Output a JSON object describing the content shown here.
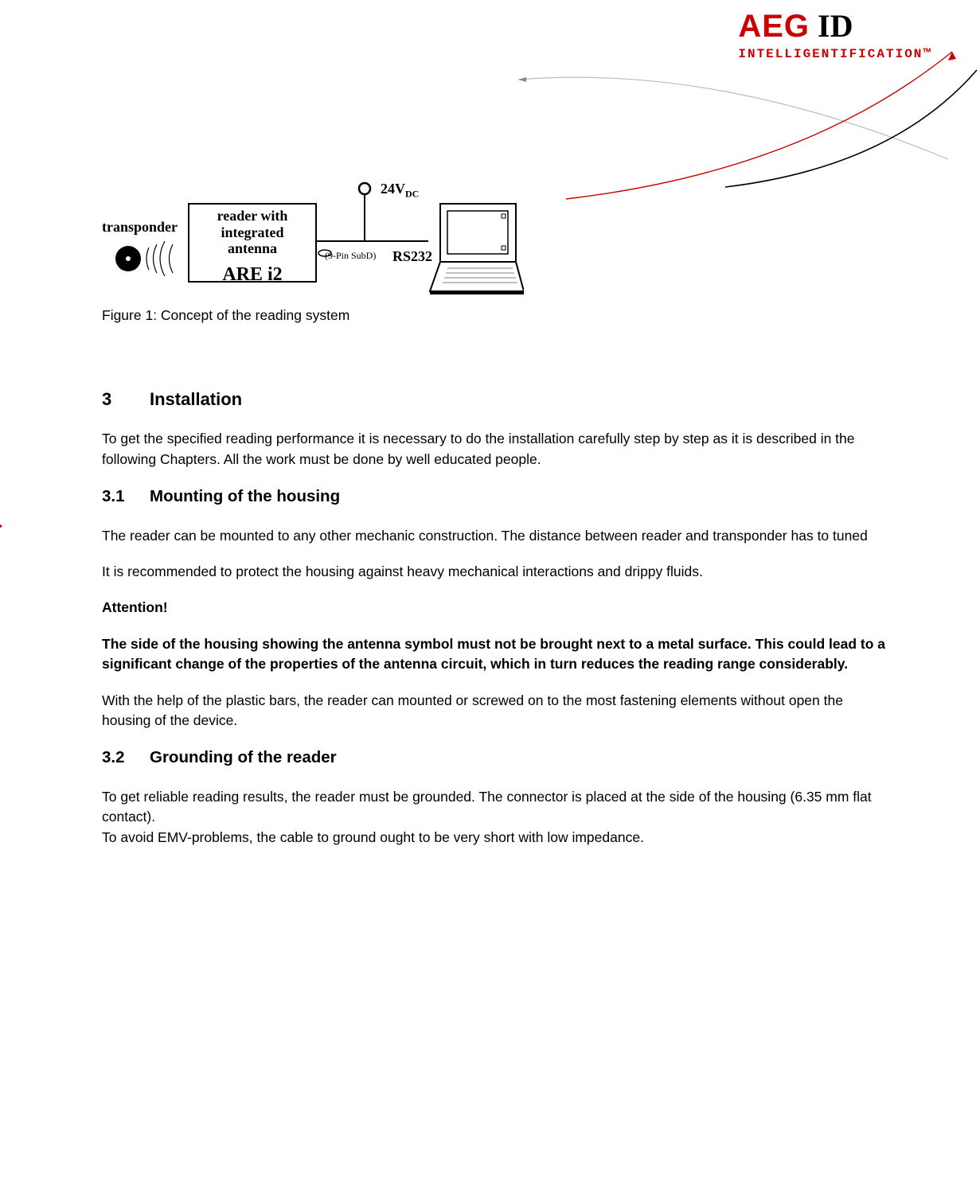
{
  "header": {
    "logo_main": "AEG",
    "logo_sub": "ID",
    "tagline": "INTELLIGENTIFICATION™"
  },
  "diagram": {
    "transponder_label": "transponder",
    "reader_line1": "reader with",
    "reader_line2": "integrated",
    "reader_line3": "antenna",
    "reader_model": "ARE i2",
    "pin_label": "(9-Pin  SubD)",
    "rs232_label": "RS232",
    "voltage_main": "24V",
    "voltage_sub": "DC",
    "caption": "Figure 1: Concept of the reading system"
  },
  "sections": {
    "s3": {
      "num": "3",
      "title": "Installation",
      "p1": "To get the specified reading performance it is necessary to do the installation carefully step by step as it is described in the following Chapters. All the work must be done by well educated people."
    },
    "s31": {
      "num": "3.1",
      "title": "Mounting of the housing",
      "p1": "The reader can be mounted to any other mechanic construction. The distance between reader and transponder has to tuned",
      "p2": "It is recommended to protect the housing against heavy mechanical interactions and drippy fluids.",
      "attn": "Attention!",
      "p3": "The side of the housing showing the antenna symbol must not be brought next to a metal surface. This could lead to a significant change of the properties of the antenna circuit, which in turn reduces the reading range considerably.",
      "p4": "With the help of the plastic bars, the reader can mounted or screwed on to the most fastening elements without open the housing of the device."
    },
    "s32": {
      "num": "3.2",
      "title": "Grounding of the reader",
      "p1": "To get reliable reading results, the reader must be grounded. The connector is placed at the side of the housing (6.35 mm flat contact).",
      "p2": "To avoid EMV-problems, the cable to ground ought to be very short with low impedance."
    }
  }
}
